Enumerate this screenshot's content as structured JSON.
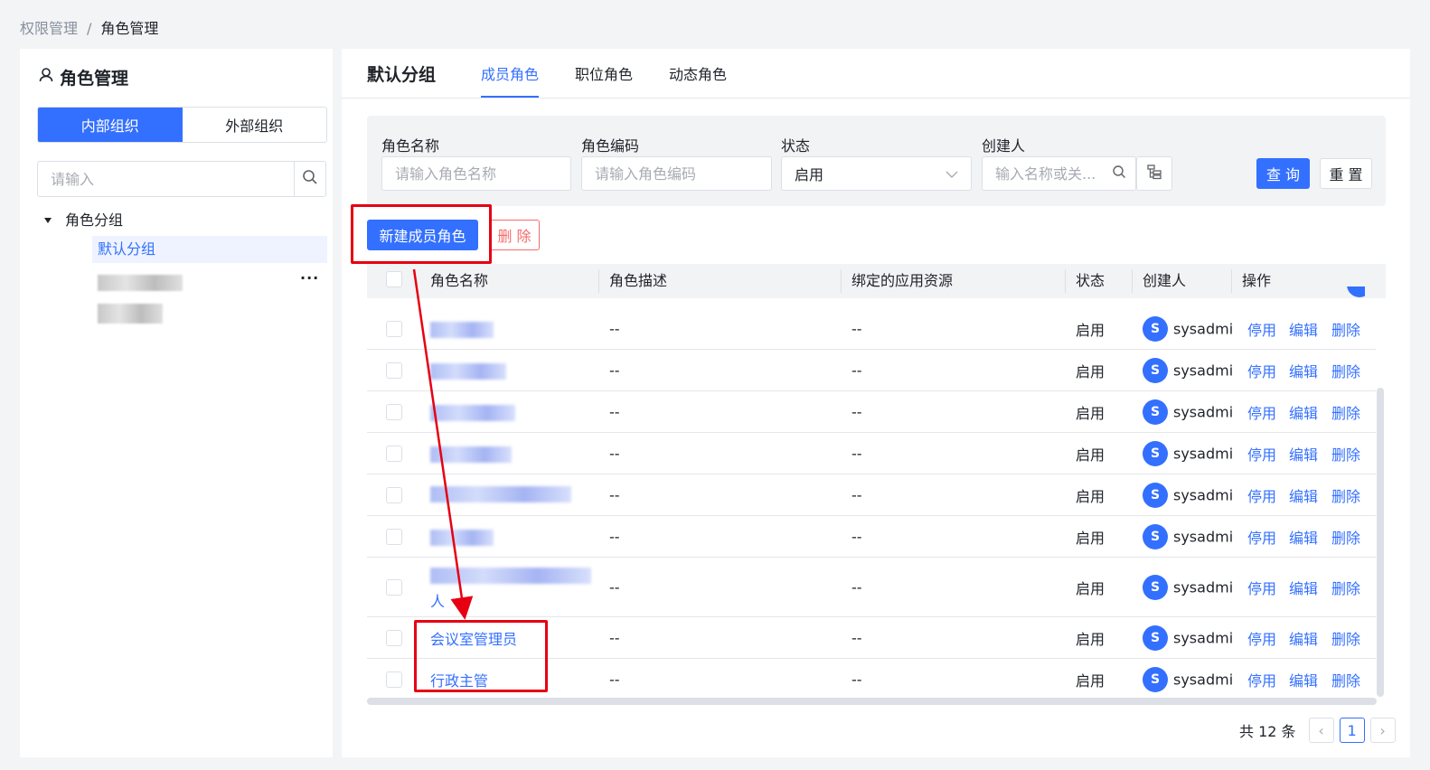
{
  "breadcrumb": {
    "parent": "权限管理",
    "sep": "/",
    "current": "角色管理"
  },
  "left": {
    "title": "角色管理",
    "segments": [
      "内部组织",
      "外部组织"
    ],
    "search_placeholder": "请输入",
    "tree_root": "角色分组",
    "tree_selected": "默认分组",
    "more": "···"
  },
  "tabs": {
    "group": "默认分组",
    "items": [
      "成员角色",
      "职位角色",
      "动态角色"
    ]
  },
  "filter": {
    "role_name_label": "角色名称",
    "role_name_placeholder": "请输入角色名称",
    "role_code_label": "角色编码",
    "role_code_placeholder": "请输入角色编码",
    "status_label": "状态",
    "status_value": "启用",
    "creator_label": "创建人",
    "creator_placeholder": "输入名称或关...",
    "query": "查 询",
    "reset": "重 置"
  },
  "actions": {
    "new_role": "新建成员角色",
    "delete": "删 除"
  },
  "table": {
    "headers": [
      "角色名称",
      "角色描述",
      "绑定的应用资源",
      "状态",
      "创建人",
      "操作"
    ],
    "rows": [
      {
        "name": "",
        "desc": "--",
        "res": "--",
        "status": "启用",
        "avatar": "S",
        "creator": "sysadmin",
        "ops": [
          "停用",
          "编辑",
          "删除"
        ]
      },
      {
        "name": "",
        "desc": "--",
        "res": "--",
        "status": "启用",
        "avatar": "S",
        "creator": "sysadmin",
        "ops": [
          "停用",
          "编辑",
          "删除"
        ]
      },
      {
        "name": "",
        "desc": "--",
        "res": "--",
        "status": "启用",
        "avatar": "S",
        "creator": "sysadmin",
        "ops": [
          "停用",
          "编辑",
          "删除"
        ]
      },
      {
        "name": "",
        "desc": "--",
        "res": "--",
        "status": "启用",
        "avatar": "S",
        "creator": "sysadmin",
        "ops": [
          "停用",
          "编辑",
          "删除"
        ]
      },
      {
        "name": "",
        "desc": "--",
        "res": "--",
        "status": "启用",
        "avatar": "S",
        "creator": "sysadmin",
        "ops": [
          "停用",
          "编辑",
          "删除"
        ]
      },
      {
        "name": "",
        "desc": "--",
        "res": "--",
        "status": "启用",
        "avatar": "S",
        "creator": "sysadmin",
        "ops": [
          "停用",
          "编辑",
          "删除"
        ]
      },
      {
        "name": "人",
        "desc": "--",
        "res": "--",
        "status": "启用",
        "avatar": "S",
        "creator": "sysadmin",
        "ops": [
          "停用",
          "编辑",
          "删除"
        ]
      },
      {
        "name": "会议室管理员",
        "desc": "--",
        "res": "--",
        "status": "启用",
        "avatar": "S",
        "creator": "sysadmin",
        "ops": [
          "停用",
          "编辑",
          "删除"
        ]
      },
      {
        "name": "行政主管",
        "desc": "--",
        "res": "--",
        "status": "启用",
        "avatar": "S",
        "creator": "sysadmin",
        "ops": [
          "停用",
          "编辑",
          "删除"
        ]
      }
    ]
  },
  "pagination": {
    "total": "共 12 条",
    "prev": "‹",
    "page": "1",
    "next": "›"
  },
  "colors": {
    "primary": "#3370ff",
    "annotation": "#e60012",
    "danger": "#f56c6c"
  }
}
